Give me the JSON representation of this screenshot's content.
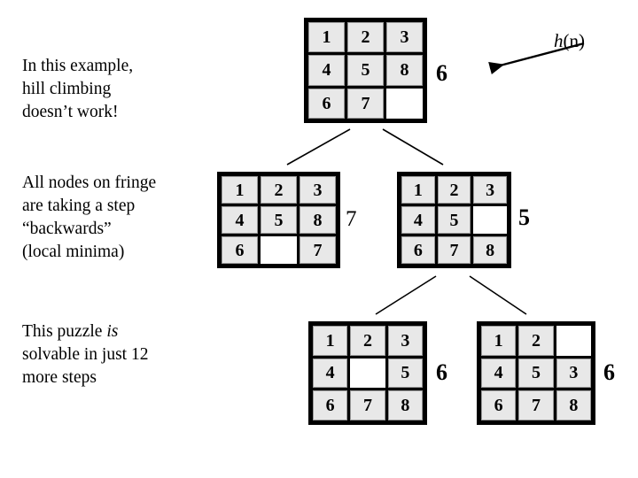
{
  "slide": {
    "title": "Hill climbing local minima example (8-puzzle)",
    "background": "#ffffff",
    "ink": "#000000",
    "tile_fill": "#e8e8e8",
    "grid_line": "#9a9a9a",
    "blank_fill": "#ffffff"
  },
  "annotations": {
    "hn_prefix": "h",
    "hn_suffix": "(n)"
  },
  "text_blocks": {
    "example": {
      "line1": "In this example,",
      "line2": "hill climbing",
      "line3": "doesn’t work!"
    },
    "fringe": {
      "line1": "All nodes on fringe",
      "line2": "are taking a step",
      "line3": "“backwards”",
      "line4": "(local minima)"
    },
    "solvable": {
      "line1_a": "This puzzle ",
      "line1_b": "is",
      "line2": "solvable in just 12",
      "line3": "more steps"
    }
  },
  "puzzles": {
    "root": {
      "name": "root-node",
      "tiles": [
        "1",
        "2",
        "3",
        "4",
        "5",
        "8",
        "6",
        "7",
        ""
      ],
      "h": "6"
    },
    "left": {
      "name": "fringe-left-node",
      "tiles": [
        "1",
        "2",
        "3",
        "4",
        "5",
        "8",
        "6",
        "",
        "7"
      ],
      "h": "7"
    },
    "right": {
      "name": "fringe-right-node",
      "tiles": [
        "1",
        "2",
        "3",
        "4",
        "5",
        "",
        "6",
        "7",
        "8"
      ],
      "h": "5"
    },
    "bottom_left": {
      "name": "child-left-node",
      "tiles": [
        "1",
        "2",
        "3",
        "4",
        "",
        "5",
        "6",
        "7",
        "8"
      ],
      "h": "6"
    },
    "bottom_right": {
      "name": "child-right-node",
      "tiles": [
        "1",
        "2",
        "",
        "4",
        "5",
        "3",
        "6",
        "7",
        "8"
      ],
      "h": "6"
    }
  }
}
